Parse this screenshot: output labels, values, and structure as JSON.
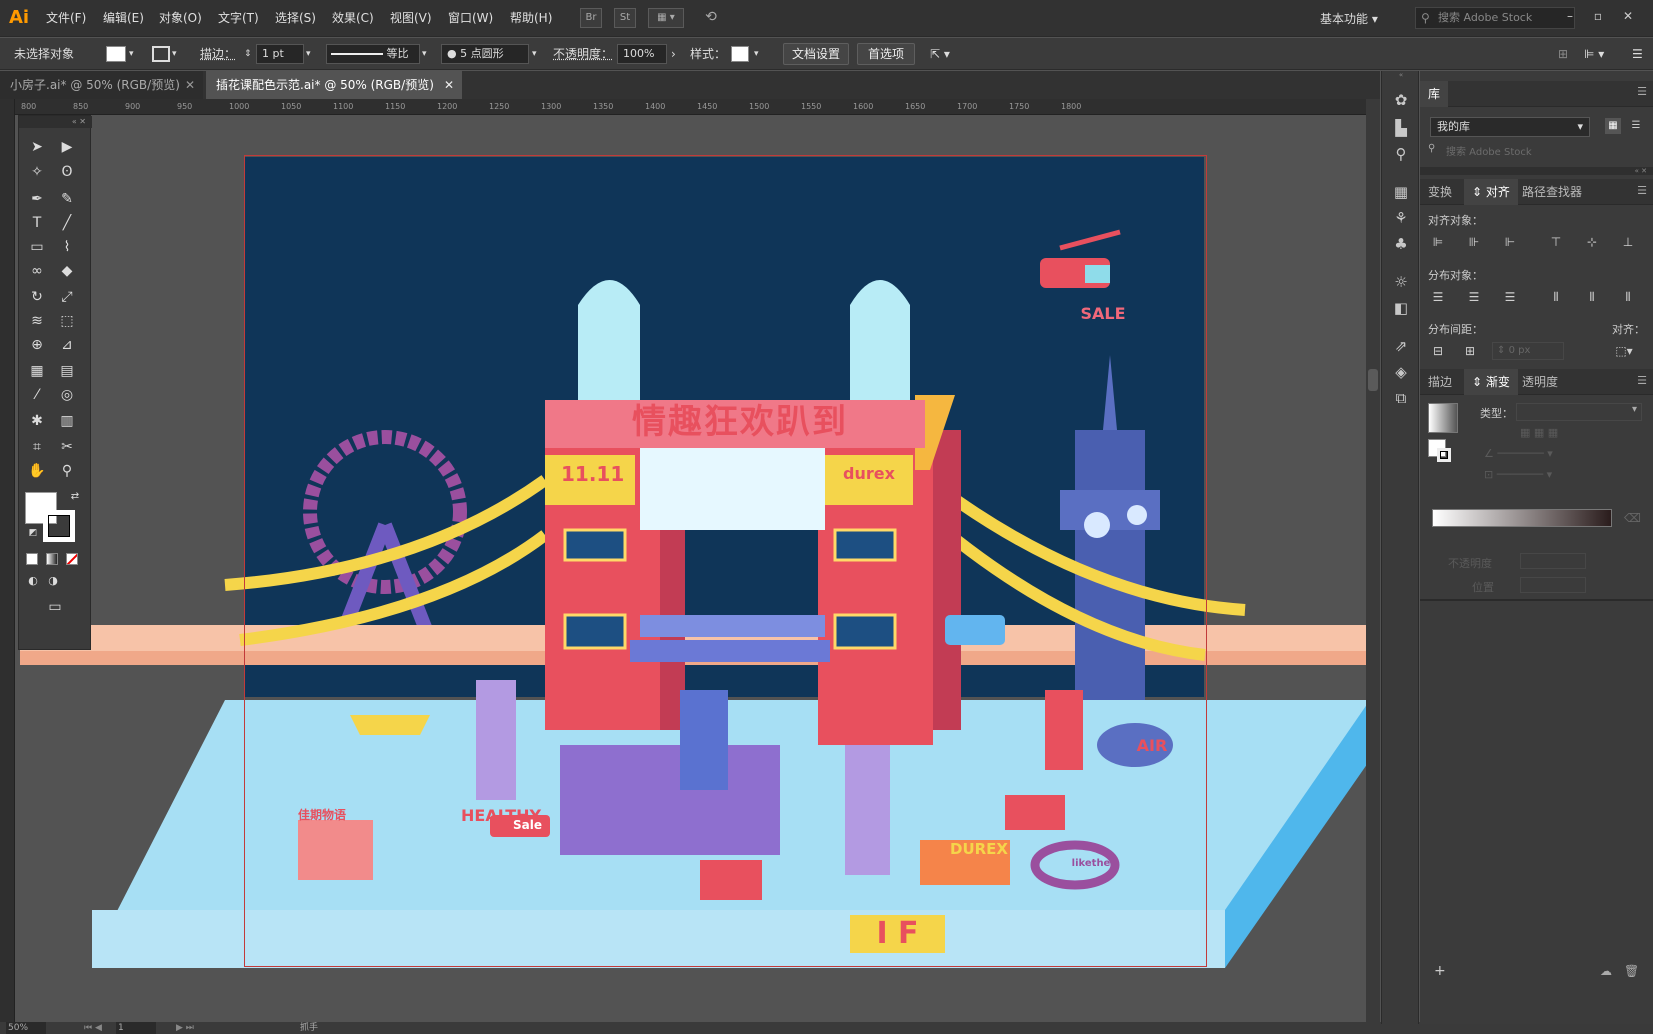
{
  "app": {
    "logo": "Ai",
    "menus": [
      "文件(F)",
      "编辑(E)",
      "对象(O)",
      "文字(T)",
      "选择(S)",
      "效果(C)",
      "视图(V)",
      "窗口(W)",
      "帮助(H)"
    ],
    "bridge_btn": "Br",
    "stock_btn": "St",
    "workspace": "基本功能",
    "search_placeholder": "搜索 Adobe Stock"
  },
  "control": {
    "selection": "未选择对象",
    "stroke_label": "描边：",
    "stroke_value": "1 pt",
    "profile": "等比",
    "brush": "5 点圆形",
    "opacity_label": "不透明度：",
    "opacity_value": "100%",
    "style_label": "样式：",
    "doc_setup": "文档设置",
    "preferences": "首选项"
  },
  "tabs": [
    {
      "label": "小房子.ai* @ 50% (RGB/预览)",
      "active": false
    },
    {
      "label": "插花课配色示范.ai* @ 50% (RGB/预览)",
      "active": true
    }
  ],
  "ruler_ticks": [
    "800",
    "850",
    "900",
    "950",
    "1000",
    "1050",
    "1100",
    "1150",
    "1200",
    "1250",
    "1300",
    "1350",
    "1400",
    "1450",
    "1500",
    "1550",
    "1600",
    "1650",
    "1700",
    "1750",
    "1800"
  ],
  "artwork": {
    "title_text": "情趣狂欢趴到",
    "badge_left": "11.11",
    "badge_right": "durex",
    "heli_sign": "SALE",
    "healthy": "HEALTHY",
    "healthy_sale": "Sale",
    "durex_shop": "DUREX",
    "air": "AIR",
    "if_sign": "I F",
    "arch_text": "佳期物语",
    "infinity_text": "likethe"
  },
  "status": {
    "zoom": "50%",
    "page": "1",
    "tool": "抓手"
  },
  "library": {
    "title": "库",
    "dropdown": "我的库",
    "search_placeholder": "搜索 Adobe Stock"
  },
  "align_panel": {
    "tabs": [
      "变换",
      "对齐",
      "路径查找器"
    ],
    "align_objects": "对齐对象：",
    "distribute_objects": "分布对象：",
    "distribute_spacing": "分布间距：",
    "align_to": "对齐：",
    "spacing_value": "0 px"
  },
  "gradient_panel": {
    "tabs": [
      "描边",
      "渐变",
      "透明度"
    ],
    "type_label": "类型：",
    "opacity_label": "不透明度",
    "position_label": "位置"
  },
  "colors": {
    "accent": "#ff9a00",
    "artboard_sky": "#0f3558",
    "tower_red": "#e8505e",
    "yellow": "#f5d54a",
    "light_blue": "#a7dff4",
    "purple": "#8e6fcf",
    "peach": "#f7c3a8"
  }
}
